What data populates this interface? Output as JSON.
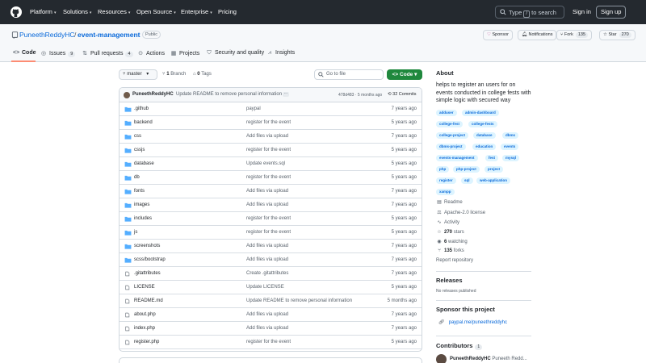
{
  "header": {
    "nav": [
      "Platform",
      "Solutions",
      "Resources",
      "Open Source",
      "Enterprise",
      "Pricing"
    ],
    "search": {
      "type": "Type",
      "slash": "/",
      "suffix": "to search"
    },
    "sign_in": "Sign in",
    "sign_up": "Sign up"
  },
  "repo": {
    "owner": "PuneethReddyHC",
    "separator": "/",
    "name": "event-management",
    "visibility": "Public",
    "sponsor": "Sponsor",
    "notifications": "Notifications",
    "fork": "Fork",
    "fork_count": "135",
    "star": "Star",
    "star_count": "270"
  },
  "tabs": [
    {
      "label": "Code",
      "icon": "code-icon",
      "count": ""
    },
    {
      "label": "Issues",
      "icon": "issue-icon",
      "count": "9"
    },
    {
      "label": "Pull requests",
      "icon": "pull-request-icon",
      "count": "4"
    },
    {
      "label": "Actions",
      "icon": "play-icon",
      "count": ""
    },
    {
      "label": "Projects",
      "icon": "table-icon",
      "count": ""
    },
    {
      "label": "Security and quality",
      "icon": "shield-icon",
      "count": ""
    },
    {
      "label": "Insights",
      "icon": "graph-icon",
      "count": ""
    }
  ],
  "branchbar": {
    "branch": "master",
    "branches_count": "1",
    "branches_label": "Branch",
    "tags_count": "0",
    "tags_label": "Tags",
    "goto_placeholder": "Go to file",
    "code_button": "Code"
  },
  "latest_commit": {
    "user": "PuneethReddyHC",
    "message": "Update README to remove personal information",
    "sha_time": "478d483 · 5 months ago",
    "commits": "32 Commits"
  },
  "files": [
    {
      "name": ".github",
      "type": "folder",
      "message": "paypal",
      "age": "7 years ago"
    },
    {
      "name": "backend",
      "type": "folder",
      "message": "register for the event",
      "age": "5 years ago"
    },
    {
      "name": "css",
      "type": "folder",
      "message": "Add files via upload",
      "age": "7 years ago"
    },
    {
      "name": "cssjs",
      "type": "folder",
      "message": "register for the event",
      "age": "5 years ago"
    },
    {
      "name": "database",
      "type": "folder",
      "message": "Update events.sql",
      "age": "5 years ago"
    },
    {
      "name": "db",
      "type": "folder",
      "message": "register for the event",
      "age": "5 years ago"
    },
    {
      "name": "fonts",
      "type": "folder",
      "message": "Add files via upload",
      "age": "7 years ago"
    },
    {
      "name": "images",
      "type": "folder",
      "message": "Add files via upload",
      "age": "7 years ago"
    },
    {
      "name": "includes",
      "type": "folder",
      "message": "register for the event",
      "age": "5 years ago"
    },
    {
      "name": "js",
      "type": "folder",
      "message": "register for the event",
      "age": "5 years ago"
    },
    {
      "name": "screenshots",
      "type": "folder",
      "message": "Add files via upload",
      "age": "7 years ago"
    },
    {
      "name": "scss/bootstrap",
      "type": "folder",
      "message": "Add files via upload",
      "age": "7 years ago"
    },
    {
      "name": ".gitattributes",
      "type": "file",
      "message": "Create .gitattributes",
      "age": "7 years ago"
    },
    {
      "name": "LICENSE",
      "type": "file",
      "message": "Update LICENSE",
      "age": "5 years ago"
    },
    {
      "name": "README.md",
      "type": "file",
      "message": "Update README to remove personal information",
      "age": "5 months ago"
    },
    {
      "name": "about.php",
      "type": "file",
      "message": "Add files via upload",
      "age": "7 years ago"
    },
    {
      "name": "index.php",
      "type": "file",
      "message": "Add files via upload",
      "age": "7 years ago"
    },
    {
      "name": "register.php",
      "type": "file",
      "message": "register for the event",
      "age": "5 years ago"
    }
  ],
  "about": {
    "heading": "About",
    "description": "helps to register an users for on events conducted in college fests with simple logic with secured way",
    "topics": [
      "adduser",
      "admin-dashboard",
      "college-fest",
      "college-fests",
      "college-project",
      "database",
      "dbms",
      "dbms-project",
      "education",
      "events",
      "events-management",
      "fest",
      "mysql",
      "php",
      "php-project",
      "project",
      "register",
      "sql",
      "web-application",
      "xampp"
    ],
    "readme": "Readme",
    "license": "Apache-2.0 license",
    "activity": "Activity",
    "stars_count": "270",
    "stars_label": "stars",
    "watching_count": "6",
    "watching_label": "watching",
    "forks_count": "135",
    "forks_label": "forks",
    "report": "Report repository"
  },
  "releases": {
    "heading": "Releases",
    "text": "No releases published"
  },
  "sponsor": {
    "heading": "Sponsor this project",
    "link": "paypal.me/puneethreddyhc"
  },
  "contributors": {
    "heading": "Contributors",
    "count": "1",
    "user": "PuneethReddyHC",
    "name": "Puneeth Redd..."
  }
}
